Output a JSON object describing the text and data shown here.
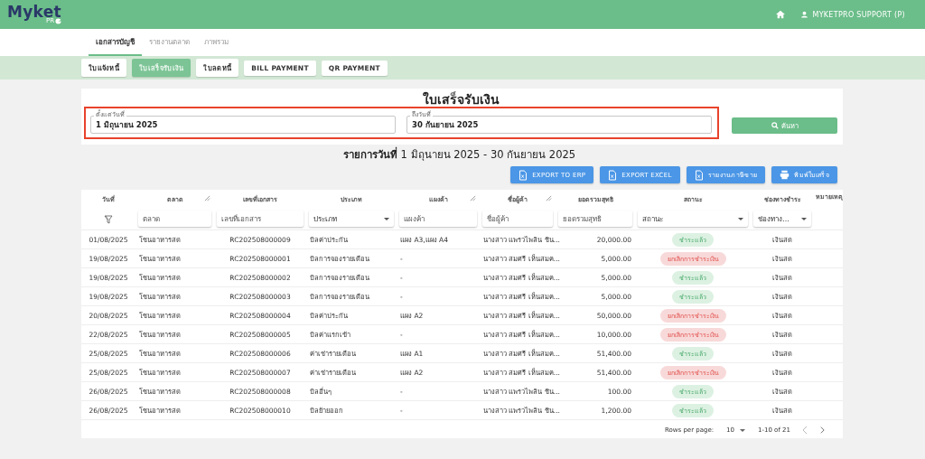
{
  "header": {
    "logo": "Myket",
    "logo_sub": "PR",
    "user": "MYKETPRO SUPPORT (P)"
  },
  "tabs": [
    {
      "label": "เอกสารบัญชี",
      "selected": true
    },
    {
      "label": "รายงานตลาด",
      "selected": false
    },
    {
      "label": "ภาพรวม",
      "selected": false
    }
  ],
  "subtabs": [
    {
      "label": "ใบแจ้งหนี้",
      "selected": false
    },
    {
      "label": "ใบเสร็จรับเงิน",
      "selected": true
    },
    {
      "label": "ใบลดหนี้",
      "selected": false
    },
    {
      "label": "BILL PAYMENT",
      "selected": false
    },
    {
      "label": "QR PAYMENT",
      "selected": false
    }
  ],
  "title": "ใบเสร็จรับเงิน",
  "date_range": {
    "highlighted": true,
    "fields": [
      {
        "label": "ตั้งแต่วันที่",
        "value": "1 มิถุนายน 2025"
      },
      {
        "label": "ถึงวันที่",
        "value": "30 กันยายน 2025"
      }
    ]
  },
  "search_button": "ค้นหา",
  "range_heading": "**รายการวันที่** 1 มิถุนายน 2025 - 30 กันยายน 2025",
  "actions": [
    {
      "label": "EXPORT TO ERP",
      "kind": "export"
    },
    {
      "label": "EXPORT EXCEL",
      "kind": "export"
    },
    {
      "label": "รายงานภาษีขาย",
      "kind": "export"
    },
    {
      "label": "พิมพ์ใบเสร็จ",
      "kind": "print"
    }
  ],
  "table": {
    "columns": [
      {
        "label": "วันที่",
        "resizable": false
      },
      {
        "label": "ตลาด",
        "resizable": true
      },
      {
        "label": "เลขที่เอกสาร",
        "resizable": false
      },
      {
        "label": "ประเภท",
        "resizable": false
      },
      {
        "label": "แผงค้า",
        "resizable": true
      },
      {
        "label": "ชื่อผู้ค้า",
        "resizable": true
      },
      {
        "label": "ยอดรวมสุทธิ",
        "resizable": false
      },
      {
        "label": "สถานะ",
        "resizable": false
      },
      {
        "label": "ช่องทางชำระ",
        "resizable": false
      },
      {
        "label": "หมายเหตุ",
        "resizable": false
      }
    ],
    "filters": [
      {
        "kind": "clear"
      },
      {
        "kind": "text",
        "placeholder": "ตลาด"
      },
      {
        "kind": "text",
        "placeholder": "เลขที่เอกสาร"
      },
      {
        "kind": "select",
        "placeholder": "ประเภท"
      },
      {
        "kind": "text",
        "placeholder": "แผงค้า"
      },
      {
        "kind": "text",
        "placeholder": "ชื่อผู้ค้า"
      },
      {
        "kind": "text",
        "placeholder": "ยอดรวมสุทธิ"
      },
      {
        "kind": "select",
        "placeholder": "สถานะ"
      },
      {
        "kind": "select",
        "placeholder": "ช่องทาง…"
      }
    ],
    "rows": [
      {
        "date": "01/08/2025",
        "market": "โซนอาหารสด",
        "doc_no": "RC202508000009",
        "type": "บิลค่าประกัน",
        "stall": "แผง A3,แผง A4",
        "vendor": "นางสาว แพรวไพลิน ชิน...",
        "total": "20,000.00",
        "status": {
          "label": "ชำระแล้ว",
          "kind": "paid"
        },
        "channel": "เงินสด"
      },
      {
        "date": "19/08/2025",
        "market": "โซนอาหารสด",
        "doc_no": "RC202508000001",
        "type": "บิลการจองรายเดือน",
        "stall": "-",
        "vendor": "นางสาว สมศรี เห็นสมค...",
        "total": "5,000.00",
        "status": {
          "label": "ยกเลิกการชำระเงิน",
          "kind": "cancelled"
        },
        "channel": "เงินสด"
      },
      {
        "date": "19/08/2025",
        "market": "โซนอาหารสด",
        "doc_no": "RC202508000002",
        "type": "บิลการจองรายเดือน",
        "stall": "-",
        "vendor": "นางสาว สมศรี เห็นสมค...",
        "total": "5,000.00",
        "status": {
          "label": "ชำระแล้ว",
          "kind": "paid"
        },
        "channel": "เงินสด"
      },
      {
        "date": "19/08/2025",
        "market": "โซนอาหารสด",
        "doc_no": "RC202508000003",
        "type": "บิลการจองรายเดือน",
        "stall": "-",
        "vendor": "นางสาว สมศรี เห็นสมค...",
        "total": "5,000.00",
        "status": {
          "label": "ชำระแล้ว",
          "kind": "paid"
        },
        "channel": "เงินสด"
      },
      {
        "date": "20/08/2025",
        "market": "โซนอาหารสด",
        "doc_no": "RC202508000004",
        "type": "บิลค่าประกัน",
        "stall": "แผง A2",
        "vendor": "นางสาว สมศรี เห็นสมค...",
        "total": "50,000.00",
        "status": {
          "label": "ยกเลิกการชำระเงิน",
          "kind": "cancelled"
        },
        "channel": "เงินสด"
      },
      {
        "date": "22/08/2025",
        "market": "โซนอาหารสด",
        "doc_no": "RC202508000005",
        "type": "บิลค่าแรกเข้า",
        "stall": "-",
        "vendor": "นางสาว สมศรี เห็นสมค...",
        "total": "10,000.00",
        "status": {
          "label": "ยกเลิกการชำระเงิน",
          "kind": "cancelled"
        },
        "channel": "เงินสด"
      },
      {
        "date": "25/08/2025",
        "market": "โซนอาหารสด",
        "doc_no": "RC202508000006",
        "type": "ค่าเช่ารายเดือน",
        "stall": "แผง A1",
        "vendor": "นางสาว สมศรี เห็นสมค...",
        "total": "51,400.00",
        "status": {
          "label": "ชำระแล้ว",
          "kind": "paid"
        },
        "channel": "เงินสด"
      },
      {
        "date": "25/08/2025",
        "market": "โซนอาหารสด",
        "doc_no": "RC202508000007",
        "type": "ค่าเช่ารายเดือน",
        "stall": "แผง A2",
        "vendor": "นางสาว สมศรี เห็นสมค...",
        "total": "51,400.00",
        "status": {
          "label": "ยกเลิกการชำระเงิน",
          "kind": "cancelled"
        },
        "channel": "เงินสด"
      },
      {
        "date": "26/08/2025",
        "market": "โซนอาหารสด",
        "doc_no": "RC202508000008",
        "type": "บิลอื่นๆ",
        "stall": "-",
        "vendor": "นางสาว แพรวไพลิน ชิน...",
        "total": "100.00",
        "status": {
          "label": "ชำระแล้ว",
          "kind": "paid"
        },
        "channel": "เงินสด"
      },
      {
        "date": "26/08/2025",
        "market": "โซนอาหารสด",
        "doc_no": "RC202508000010",
        "type": "บิลย้ายออก",
        "stall": "-",
        "vendor": "นางสาว แพรวไพลิน ชิน...",
        "total": "1,200.00",
        "status": {
          "label": "ชำระแล้ว",
          "kind": "paid"
        },
        "channel": "เงินสด"
      }
    ]
  },
  "pagination": {
    "rows_per_page_label": "Rows per page:",
    "rows_per_page": "10",
    "range": "1-10 of 21"
  }
}
